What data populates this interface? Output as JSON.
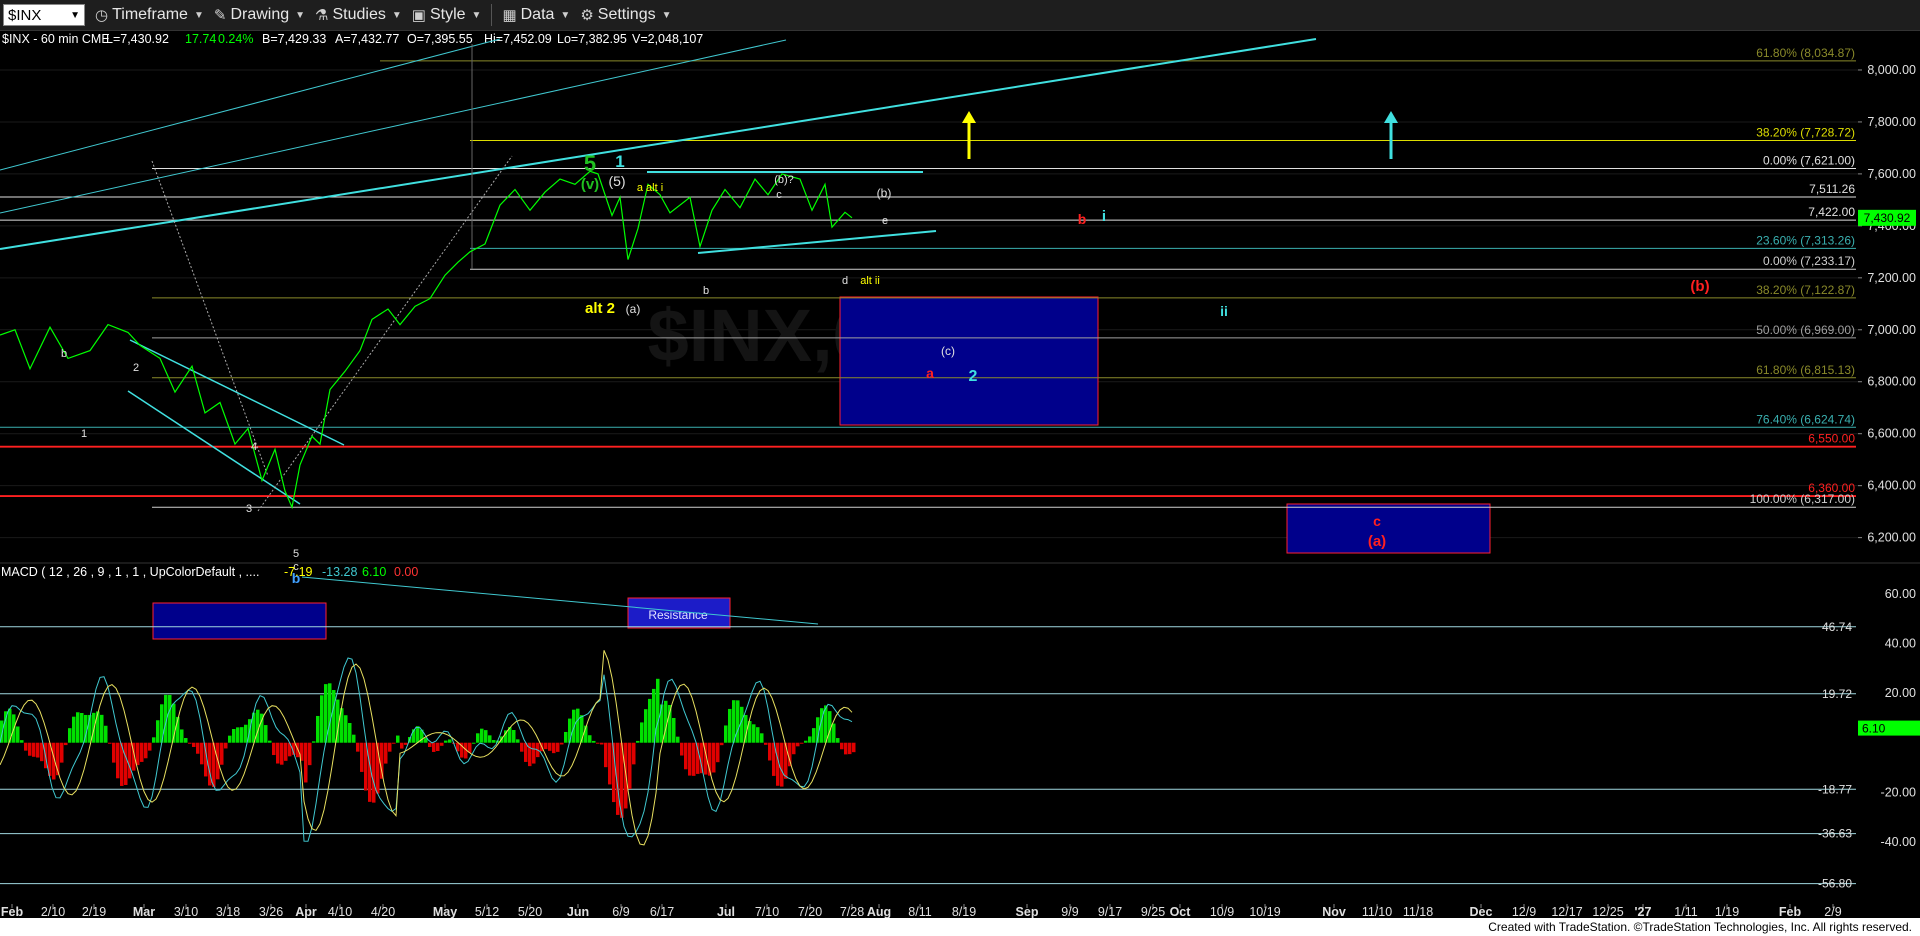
{
  "toolbar": {
    "symbol": "$INX",
    "timeframe": "Timeframe",
    "drawing": "Drawing",
    "studies": "Studies",
    "style": "Style",
    "data": "Data",
    "settings": "Settings"
  },
  "header": {
    "quote": "$INX - 60 min CME",
    "last": "L=7,430.92",
    "change": "17.74",
    "pct": "0.24%",
    "bid": "B=7,429.33",
    "ask": "A=7,432.77",
    "open": "O=7,395.55",
    "high": "Hi=7,452.09",
    "low": "Lo=7,382.95",
    "volume": "V=2,048,107"
  },
  "watermark": "$INX,60Min",
  "footer": "Created with TradeStation. ©TradeStation Technologies, Inc. All rights reserved.",
  "colors": {
    "price": "#00ff00",
    "cyan": "#40e0e0",
    "red": "#ff0000",
    "yellow": "#ffff00",
    "box": "#00008b"
  },
  "chart_data": [
    {
      "type": "line",
      "title": "",
      "series": [
        {
          "values": [
            7300,
            7480,
            7620,
            7250,
            7580,
            7290,
            7600,
            7380,
            7452,
            7430.92
          ]
        }
      ],
      "ylim": [
        6110,
        8100
      ],
      "y_ticks": [
        {
          "v": 6200,
          "label": "6,200.00"
        },
        {
          "v": 6400,
          "label": "6,400.00"
        },
        {
          "v": 6600,
          "label": "6,600.00"
        },
        {
          "v": 6800,
          "label": "6,800.00"
        },
        {
          "v": 7000,
          "label": "7,000.00"
        },
        {
          "v": 7200,
          "label": "7,200.00"
        },
        {
          "v": 7400,
          "label": "7,400.00"
        },
        {
          "v": 7600,
          "label": "7,600.00"
        },
        {
          "v": 7800,
          "label": "7,800.00"
        },
        {
          "v": 8000,
          "label": "8,000.00"
        }
      ],
      "last_price": {
        "v": 7430.92,
        "label": "7,430.92"
      },
      "x_labels": [
        "Feb",
        "2/10",
        "2/19",
        "Mar",
        "3/10",
        "3/18",
        "3/26",
        "Apr",
        "4/10",
        "4/20",
        "May",
        "5/12",
        "5/20",
        "Jun",
        "6/9",
        "6/17",
        "Jul",
        "7/10",
        "7/20",
        "7/28",
        "Aug",
        "8/11",
        "8/19",
        "Sep",
        "9/9",
        "9/17",
        "9/25",
        "Oct",
        "10/9",
        "10/19",
        "Nov",
        "11/10",
        "11/18",
        "Dec",
        "12/9",
        "12/17",
        "12/25",
        "'27",
        "1/11",
        "1/19",
        "Feb",
        "2/9"
      ],
      "levels": [
        {
          "v": 8034.87,
          "label": "61.80% (8,034.87)",
          "color": "#8a8a2a"
        },
        {
          "v": 7728.72,
          "label": "38.20% (7,728.72)",
          "color": "#dddd00"
        },
        {
          "v": 7621.0,
          "label": "0.00% (7,621.00)",
          "color": "#e0e0e0"
        },
        {
          "v": 7511.26,
          "label": "7,511.26",
          "color": "#e0e0e0"
        },
        {
          "v": 7422.0,
          "label": "7,422.00",
          "color": "#e0e0e0"
        },
        {
          "v": 7313.26,
          "label": "23.60% (7,313.26)",
          "color": "#3ab0b0"
        },
        {
          "v": 7233.17,
          "label": "0.00% (7,233.17)",
          "color": "#d0d0d0"
        },
        {
          "v": 7122.87,
          "label": "38.20% (7,122.87)",
          "color": "#8a8a2a"
        },
        {
          "v": 6969.0,
          "label": "50.00% (6,969.00)",
          "color": "#a0a0a0"
        },
        {
          "v": 6815.13,
          "label": "61.80% (6,815.13)",
          "color": "#8a8a2a"
        },
        {
          "v": 6624.74,
          "label": "76.40% (6,624.74)",
          "color": "#3ab0b0"
        },
        {
          "v": 6550.0,
          "label": "6,550.00",
          "color": "#ff2020"
        },
        {
          "v": 6360.0,
          "label": "6,360.00",
          "color": "#ff2020"
        },
        {
          "v": 6317.0,
          "label": "100.00% (6,317.00)",
          "color": "#d0d0d0"
        }
      ],
      "annotations": [
        "5",
        "1",
        "(v)",
        "(5)",
        "a alt i",
        "(b)?",
        "c",
        "(b)",
        "e",
        "b",
        "i",
        "d",
        "alt ii",
        "(b)",
        "b",
        "alt 2",
        "(a)",
        "ii",
        "(c)",
        "a",
        "2",
        "b",
        "2",
        "1",
        "4",
        "3",
        "5",
        "c",
        "b",
        "c",
        "(a)"
      ]
    },
    {
      "type": "line",
      "title": "MACD ( 12 , 26 , 9 , 1 , 1 , UpColorDefault , ....",
      "macd_values": [
        "-7.19",
        "-13.28",
        "6.10",
        "0.00"
      ],
      "ylim": [
        -65,
        68
      ],
      "y_ticks": [
        {
          "v": 60,
          "label": "60.00"
        },
        {
          "v": 40,
          "label": "40.00"
        },
        {
          "v": 20,
          "label": "20.00"
        },
        {
          "v": -20,
          "label": "-20.00"
        },
        {
          "v": -40,
          "label": "-40.00"
        }
      ],
      "levels": [
        {
          "v": 46.74,
          "label": "46.74"
        },
        {
          "v": 19.72,
          "label": "19.72"
        },
        {
          "v": -18.77,
          "label": "-18.77"
        },
        {
          "v": -36.63,
          "label": "-36.63"
        },
        {
          "v": -56.8,
          "label": "-56.80"
        }
      ],
      "current": {
        "v": 6.1,
        "label": "6.10"
      },
      "resistance_label": "Resistance"
    }
  ]
}
